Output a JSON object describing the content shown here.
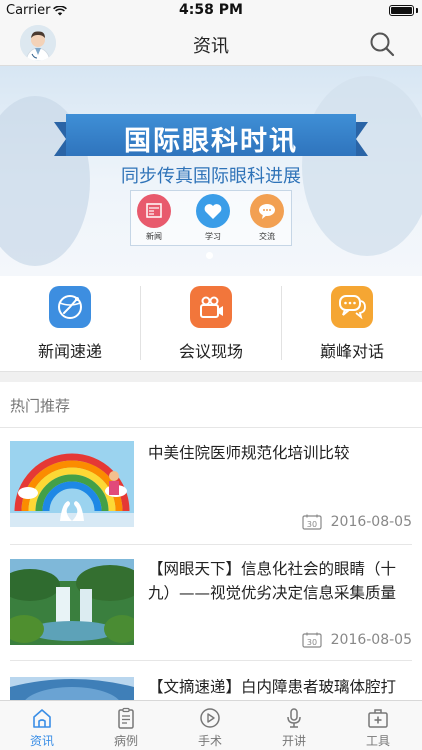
{
  "status_bar": {
    "carrier": "Carrier",
    "time": "4:58 PM"
  },
  "nav": {
    "title": "资讯"
  },
  "banner": {
    "title": "国际眼科时讯",
    "subtitle": "同步传真国际眼科进展",
    "items": [
      {
        "label": "新闻",
        "color": "#e85a6d"
      },
      {
        "label": "学习",
        "color": "#3a9de8"
      },
      {
        "label": "交流",
        "color": "#f2a052"
      }
    ]
  },
  "categories": [
    {
      "label": "新闻速递",
      "icon": "globe-icon",
      "color": "#3d8ee0"
    },
    {
      "label": "会议现场",
      "icon": "video-camera-icon",
      "color": "#f2763b"
    },
    {
      "label": "巅峰对话",
      "icon": "chat-bubble-icon",
      "color": "#f5a633"
    }
  ],
  "section": {
    "title": "热门推荐"
  },
  "news": [
    {
      "title": "中美住院医师规范化培训比较",
      "date": "2016-08-05",
      "calendar_day": "30"
    },
    {
      "title": "【网眼天下】信息化社会的眼睛（十九）——视觉优劣决定信息采集质量",
      "date": "2016-08-05",
      "calendar_day": "30"
    },
    {
      "title": "【文摘速递】白内障患者玻璃体腔打",
      "date": "",
      "calendar_day": ""
    }
  ],
  "tabs": [
    {
      "label": "资讯",
      "icon": "home-icon",
      "active": true
    },
    {
      "label": "病例",
      "icon": "clipboard-icon",
      "active": false
    },
    {
      "label": "手术",
      "icon": "play-circle-icon",
      "active": false
    },
    {
      "label": "开讲",
      "icon": "microphone-icon",
      "active": false
    },
    {
      "label": "工具",
      "icon": "medical-kit-icon",
      "active": false
    }
  ],
  "colors": {
    "accent": "#3a8ee6",
    "tab_inactive": "#777777"
  }
}
